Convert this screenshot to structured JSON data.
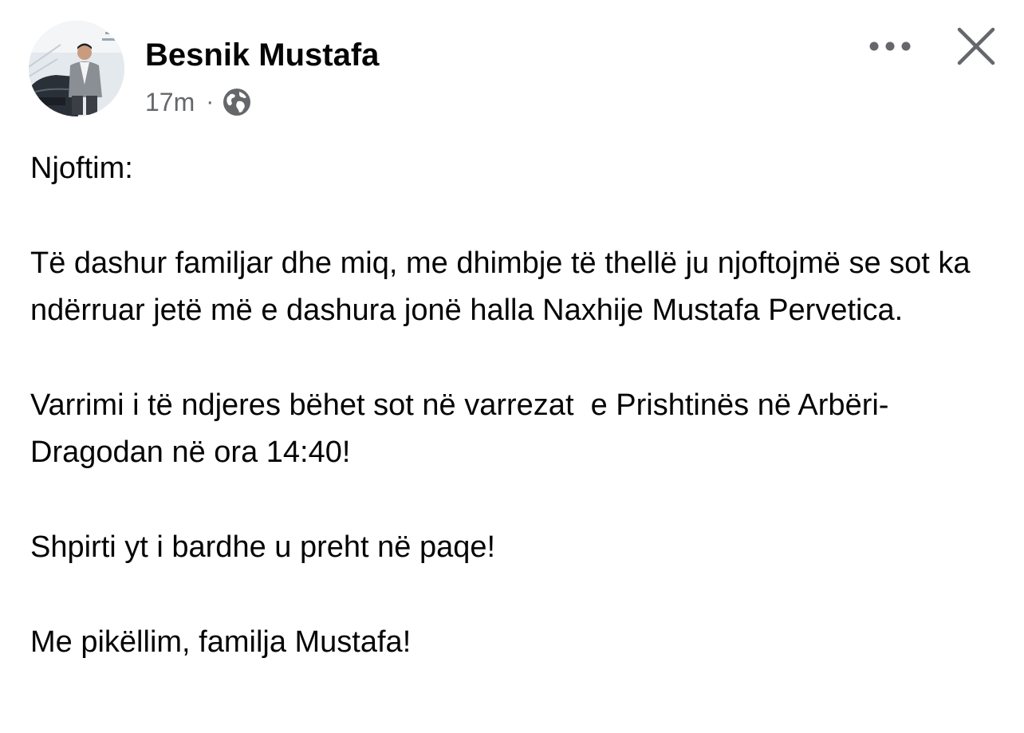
{
  "post": {
    "author": "Besnik Mustafa",
    "time": "17m",
    "separator": "·",
    "audience_icon": "globe-icon",
    "paragraphs": [
      "Njoftim:",
      "Të dashur familjar dhe miq, me dhimbje të thellë ju njoftojmë se sot ka ndërruar jetë më e dashura jonë halla Naxhije Mustafa Pervetica.",
      "Varrimi i të ndjeres bëhet sot në varrezat  e Prishtinës në Arbëri-Dragodan në ora 14:40!",
      "Shpirti yt i bardhe u preht në paqe!",
      "Me pikëllim, familja Mustafa!"
    ]
  },
  "header": {
    "more_icon": "more-options-icon",
    "close_icon": "close-icon"
  },
  "colors": {
    "text": "#050505",
    "secondary_text": "#65676b",
    "background": "#ffffff"
  }
}
